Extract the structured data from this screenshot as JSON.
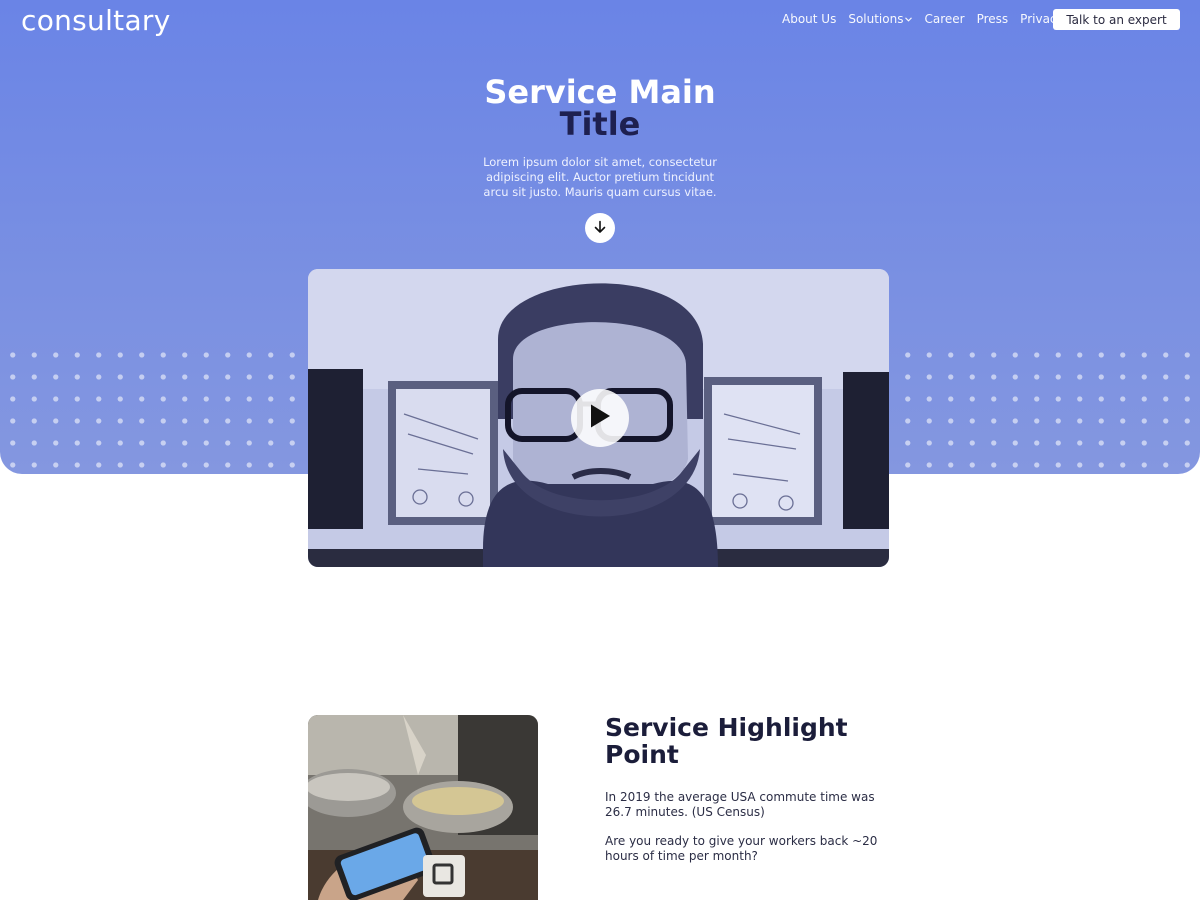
{
  "brand": {
    "logo": "consultary"
  },
  "nav": {
    "items": [
      "About Us",
      "Solutions",
      "Career",
      "Press",
      "Privacy"
    ],
    "cta": "Talk to an expert"
  },
  "hero": {
    "title_line1": "Service Main",
    "title_line2": "Title",
    "description": "Lorem ipsum dolor sit amet, consectetur adipiscing elit. Auctor pretium tincidunt arcu sit justo. Mauris quam cursus vitae."
  },
  "highlight": {
    "title": "Service Highlight Point",
    "paragraph1": "In 2019 the average USA commute time was 26.7 minutes. (US Census)",
    "paragraph2": "Are you ready to give your workers back ~20 hours of time per month?"
  },
  "icons": {
    "down": "arrow-down-icon",
    "play": "play-icon",
    "chevron": "chevron-down-icon"
  },
  "colors": {
    "hero_gradient_top": "#6a84e6",
    "hero_gradient_bottom": "#8497e0",
    "title_dark": "#1e2050",
    "heading_dark": "#1b1d3a"
  }
}
